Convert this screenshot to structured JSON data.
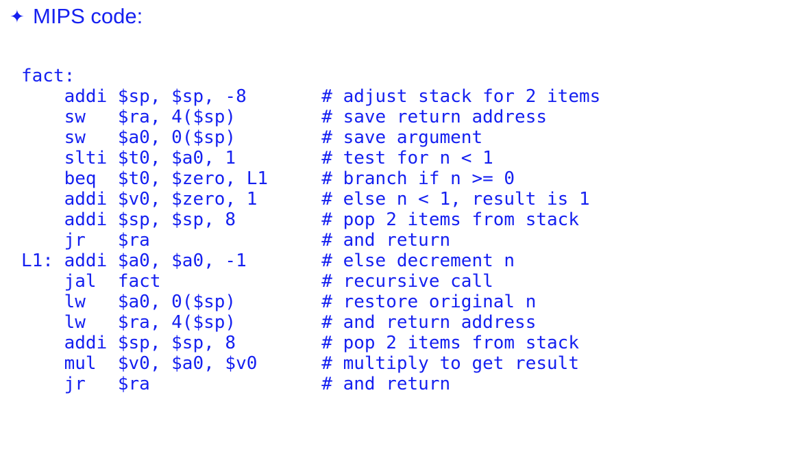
{
  "slide": {
    "background_color": "#ffffff",
    "text_color": "#1520f0"
  },
  "heading": {
    "bullet_icon": "four-pointed-star-bullet",
    "bullet_glyph": "✦",
    "text": "MIPS code:"
  },
  "code": {
    "language": "MIPS assembly",
    "label_field_width": 4,
    "mnemonic_field_width": 5,
    "comment_column": 24,
    "lines": [
      "fact:",
      "    addi $sp, $sp, -8       # adjust stack for 2 items",
      "    sw   $ra, 4($sp)        # save return address",
      "    sw   $a0, 0($sp)        # save argument",
      "    slti $t0, $a0, 1        # test for n < 1",
      "    beq  $t0, $zero, L1     # branch if n >= 0",
      "    addi $v0, $zero, 1      # else n < 1, result is 1",
      "    addi $sp, $sp, 8        # pop 2 items from stack",
      "    jr   $ra                # and return",
      "L1: addi $a0, $a0, -1       # else decrement n",
      "    jal  fact               # recursive call",
      "    lw   $a0, 0($sp)        # restore original n",
      "    lw   $ra, 4($sp)        # and return address",
      "    addi $sp, $sp, 8        # pop 2 items from stack",
      "    mul  $v0, $a0, $v0      # multiply to get result",
      "    jr   $ra                # and return"
    ]
  }
}
